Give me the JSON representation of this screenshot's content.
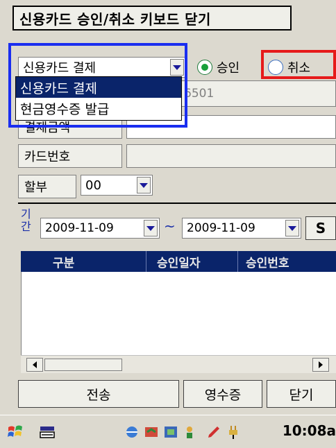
{
  "toolbar": {
    "title_label": "신용카드 승인/취소 키보드 닫기"
  },
  "payment": {
    "type_selected": "신용카드 결제",
    "options": [
      "신용카드 결제",
      "현금영수증 발급"
    ],
    "radio_approve": "승인",
    "radio_cancel": "취소",
    "approve_selected": true
  },
  "fields": {
    "merchant_partial": "6501",
    "amount_label_partial": "결제금액",
    "card_number_label": "카드번호",
    "installment_label": "할부",
    "installment_value": "00"
  },
  "period": {
    "label_line1": "기",
    "label_line2": "간",
    "from": "2009-11-09",
    "tilde": "~",
    "to": "2009-11-09",
    "search_label": "S"
  },
  "grid": {
    "columns": [
      "구분",
      "승인일자",
      "승인번호"
    ]
  },
  "buttons": {
    "send": "전송",
    "receipt": "영수증",
    "close": "닫기"
  },
  "taskbar": {
    "clock": "10:08a"
  },
  "colors": {
    "highlight_blue": "#1a2ef0",
    "highlight_red": "#e61a1a",
    "selection": "#0a246a"
  }
}
